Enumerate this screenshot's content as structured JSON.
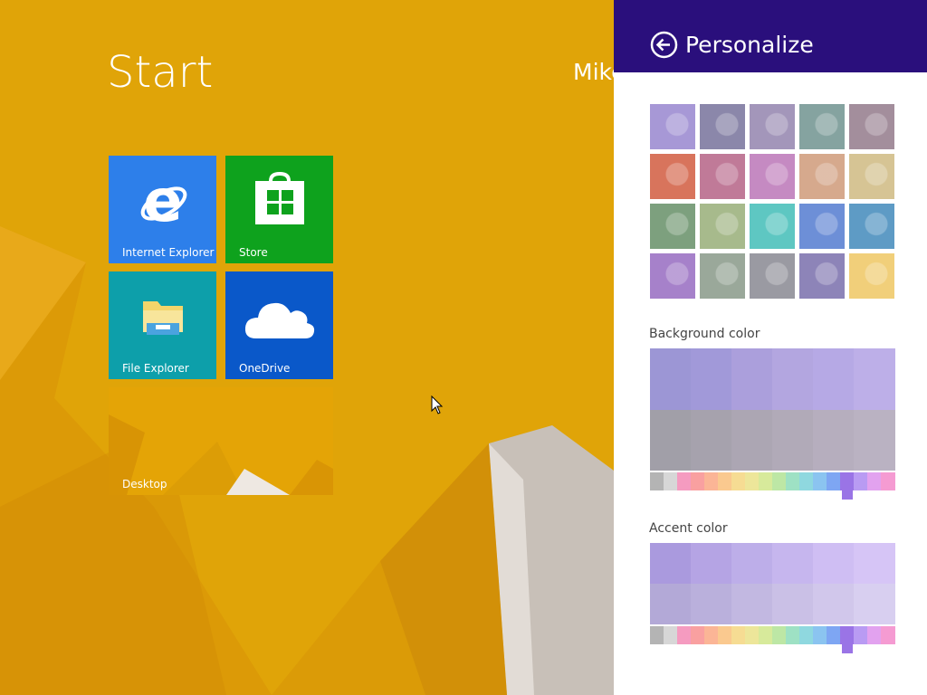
{
  "start": {
    "title": "Start",
    "user": "Mike",
    "background_color": "#e0a408"
  },
  "tiles": [
    {
      "id": "internet-explorer",
      "label": "Internet Explorer",
      "color": "#2d7fea",
      "icon": "internet-explorer-icon"
    },
    {
      "id": "store",
      "label": "Store",
      "color": "#0ea21d",
      "icon": "store-icon"
    },
    {
      "id": "file-explorer",
      "label": "File Explorer",
      "color": "#0d9faa",
      "icon": "folder-icon"
    },
    {
      "id": "onedrive",
      "label": "OneDrive",
      "color": "#0a58c9",
      "icon": "cloud-icon"
    },
    {
      "id": "desktop",
      "label": "Desktop",
      "color": "#e4a406",
      "icon": "desktop-wallpaper"
    }
  ],
  "panel": {
    "title": "Personalize",
    "back_icon": "back-arrow-icon",
    "header_color": "#2a0f7c",
    "patterns": [
      [
        "#a798d6",
        "#8b87aa",
        "#a396ba",
        "#85a3a0",
        "#a38e9c"
      ],
      [
        "#d8745c",
        "#c07a98",
        "#c58ac2",
        "#d6a98d",
        "#d6c494"
      ],
      [
        "#7da07e",
        "#a7ba8c",
        "#5ec7c2",
        "#6d8fd7",
        "#5e9bc5"
      ],
      [
        "#a681ca",
        "#9aa89a",
        "#9a9aa2",
        "#8d84b8",
        "#f1cf7a"
      ]
    ],
    "background_color_label": "Background color",
    "accent_color_label": "Accent color",
    "background_swatches": [
      [
        "#9c96d5",
        "#a199d9",
        "#ab9fdc",
        "#b3a6e0",
        "#b6a9e5",
        "#bdafe8"
      ],
      [
        "#a19fa8",
        "#a6a2ad",
        "#aca6b3",
        "#b1aab8",
        "#b6aebe",
        "#bab2c2"
      ]
    ],
    "accent_swatches": [
      [
        "#aa9ade",
        "#b5a4e4",
        "#bdaee9",
        "#c6b6ee",
        "#cfbef3",
        "#d6c5f6"
      ],
      [
        "#b3a9d7",
        "#bab0dc",
        "#c2b8e1",
        "#cac0e6",
        "#d1c7eb",
        "#d8cff0"
      ]
    ],
    "hue_colors": [
      "#b4b4b4",
      "#d7d7d7",
      "#f59bc0",
      "#f9a0a0",
      "#fbb596",
      "#fac98f",
      "#f6dc93",
      "#ede69a",
      "#d7ea9b",
      "#bde7a5",
      "#9ee1c4",
      "#8fd8df",
      "#8bc4f0",
      "#7ea6f3",
      "#9a74e6",
      "#b99bf3",
      "#e2a2ef",
      "#f59bd2"
    ],
    "selected_hue_index": 14
  }
}
